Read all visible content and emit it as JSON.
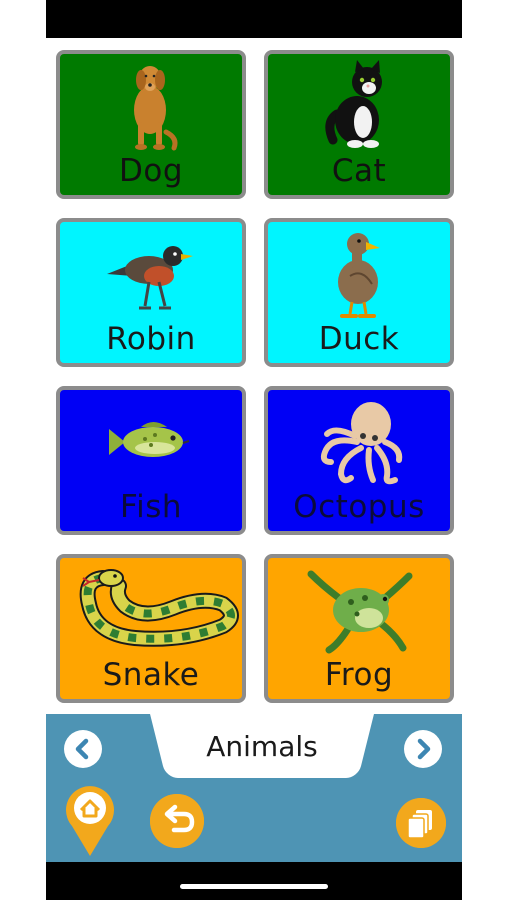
{
  "board": {
    "tiles": [
      {
        "label": "Dog",
        "icon": "dog-icon",
        "bg": "#007a00"
      },
      {
        "label": "Cat",
        "icon": "cat-icon",
        "bg": "#007a00"
      },
      {
        "label": "Robin",
        "icon": "robin-icon",
        "bg": "#00f5ff"
      },
      {
        "label": "Duck",
        "icon": "duck-icon",
        "bg": "#00f5ff"
      },
      {
        "label": "Fish",
        "icon": "fish-icon",
        "bg": "#0000f5"
      },
      {
        "label": "Octopus",
        "icon": "octopus-icon",
        "bg": "#0000f5"
      },
      {
        "label": "Snake",
        "icon": "snake-icon",
        "bg": "#ffa500"
      },
      {
        "label": "Frog",
        "icon": "frog-icon",
        "bg": "#ffa500"
      }
    ]
  },
  "footer": {
    "folder_title": "Animals",
    "prev_icon": "chevron-left-icon",
    "next_icon": "chevron-right-icon",
    "home_icon": "home-icon",
    "back_icon": "undo-icon",
    "pages_icon": "pages-icon",
    "bar_color": "#4e94b4",
    "button_color": "#f2a81c"
  }
}
